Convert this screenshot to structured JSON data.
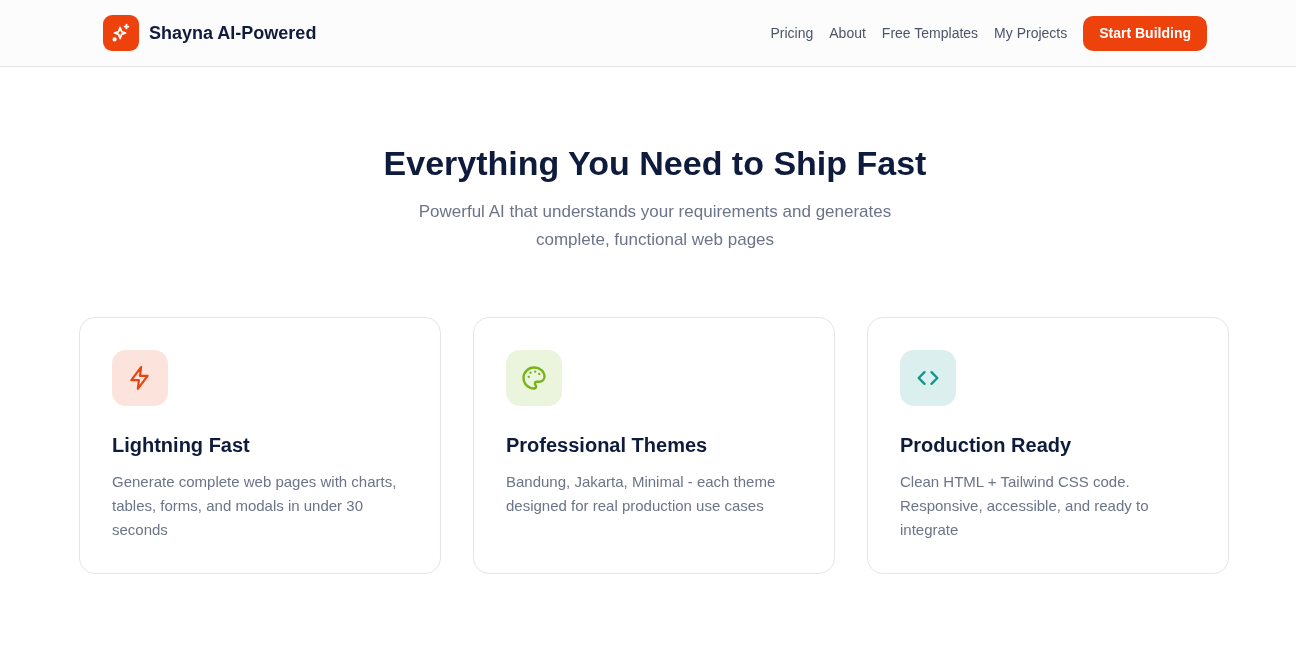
{
  "header": {
    "brand": "Shayna AI-Powered",
    "nav": [
      {
        "label": "Pricing"
      },
      {
        "label": "About"
      },
      {
        "label": "Free Templates"
      },
      {
        "label": "My Projects"
      }
    ],
    "cta": "Start Building"
  },
  "hero": {
    "title": "Everything You Need to Ship Fast",
    "subtitle": "Powerful AI that understands your requirements and generates complete, functional web pages"
  },
  "features": [
    {
      "kind": "bolt",
      "color": "#e8430f",
      "title": "Lightning Fast",
      "description": "Generate complete web pages with charts, tables, forms, and modals in under 30 seconds"
    },
    {
      "kind": "palette",
      "color": "#79b31a",
      "title": "Professional Themes",
      "description": "Bandung, Jakarta, Minimal - each theme designed for real production use cases"
    },
    {
      "kind": "code",
      "color": "#0f968a",
      "title": "Production Ready",
      "description": "Clean HTML + Tailwind CSS code. Responsive, accessible, and ready to integrate"
    }
  ]
}
